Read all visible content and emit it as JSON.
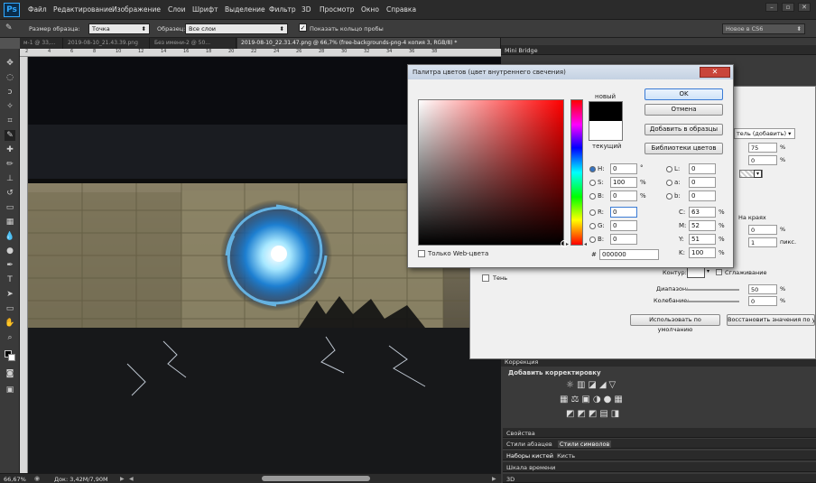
{
  "app": {
    "logo": "Ps"
  },
  "menu": [
    "Файл",
    "Редактирование",
    "Изображение",
    "Слои",
    "Шрифт",
    "Выделение",
    "Фильтр",
    "3D",
    "Просмотр",
    "Окно",
    "Справка"
  ],
  "options": {
    "sample_size_label": "Размер образца:",
    "sample_size_value": "Точка",
    "sample_label": "Образец:",
    "sample_value": "Все слои",
    "show_ring_label": "Показать кольцо пробы",
    "workspace": "Новое в CS6"
  },
  "tabs": [
    "м-1 @ 33,...",
    "2019-08-10_21.43.39.png",
    "Без имени-2 @ 50...",
    "2019-08-10_22.31.47.png @ 66,7% (free-backgrounds-png-4 копия 3, RGB/8) *"
  ],
  "ruler_ticks": [
    "2",
    "4",
    "6",
    "8",
    "10",
    "12",
    "14",
    "16",
    "18",
    "20",
    "22",
    "24",
    "26",
    "28",
    "30",
    "32",
    "34",
    "36",
    "38"
  ],
  "status": {
    "zoom": "66,67%",
    "doc": "Док: 3,42M/7,90M"
  },
  "right_panels": {
    "mini_bridge": "Mini Bridge",
    "correction": "Коррекция",
    "add_correction": "Добавить корректировку",
    "properties": "Свойства",
    "para_styles": "Стили абзацев",
    "char_styles": "Стили символов",
    "brush_sets": "Наборы кистей",
    "brush": "Кисть",
    "timeline": "Шкала времени",
    "three_d": "3D"
  },
  "dialog": {
    "title": "Палитра цветов (цвет внутреннего свечения)",
    "close": "✕",
    "new_label": "новый",
    "current_label": "текущий",
    "ok": "OK",
    "cancel": "Отмена",
    "add_swatches": "Добавить в образцы",
    "libraries": "Библиотеки цветов",
    "web_only": "Только Web-цвета",
    "fields": {
      "H": {
        "label": "H:",
        "value": "0",
        "unit": "°"
      },
      "S": {
        "label": "S:",
        "value": "100",
        "unit": "%"
      },
      "B": {
        "label": "B:",
        "value": "0",
        "unit": "%"
      },
      "R": {
        "label": "R:",
        "value": "0"
      },
      "G": {
        "label": "G:",
        "value": "0"
      },
      "Bl": {
        "label": "B:",
        "value": "0"
      },
      "L": {
        "label": "L:",
        "value": "0"
      },
      "a": {
        "label": "a:",
        "value": "0"
      },
      "b": {
        "label": "b:",
        "value": "0"
      },
      "C": {
        "label": "C:",
        "value": "63",
        "unit": "%"
      },
      "M": {
        "label": "M:",
        "value": "52",
        "unit": "%"
      },
      "Y": {
        "label": "Y:",
        "value": "51",
        "unit": "%"
      },
      "K": {
        "label": "K:",
        "value": "100",
        "unit": "%"
      }
    },
    "hex_label": "#",
    "hex": "000000"
  },
  "bg_dialog": {
    "blend": "тель (добавить)",
    "opacity": "75",
    "noise": "0",
    "pct": "%",
    "edges": "На краях",
    "choke": "0",
    "size": "1",
    "size_unit": "пикс.",
    "shadow_label": "Тень",
    "contour": "Контур:",
    "antialias": "Сглаживание",
    "range_label": "Диапазон:",
    "range": "50",
    "jitter_label": "Колебание:",
    "jitter": "0",
    "default_btn": "Использовать по умолчанию",
    "restore_btn": "Восстановить значения по у"
  },
  "colors": {
    "accent": "#31a8ff",
    "dialog_bg": "#f0f0f0",
    "close": "#c9453a"
  }
}
